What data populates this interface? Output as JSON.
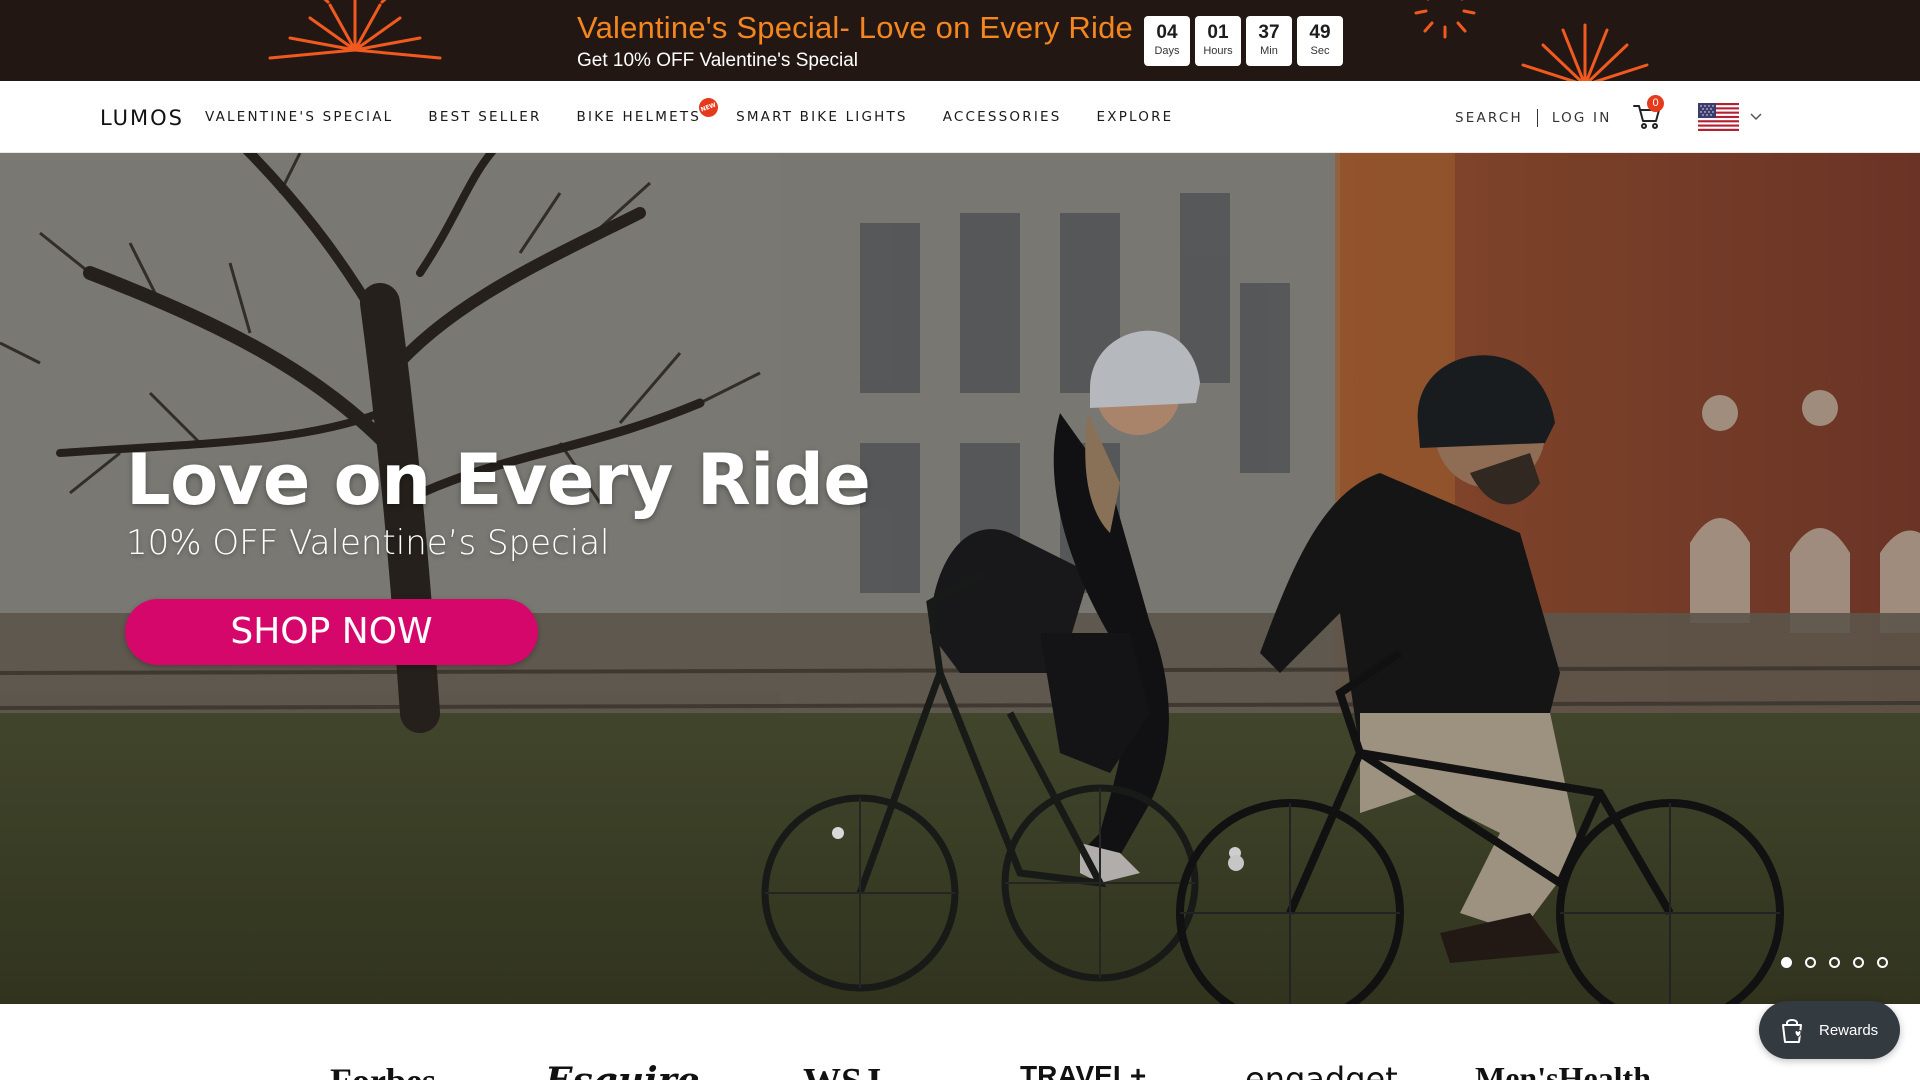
{
  "promo": {
    "title": "Valentine's Special- Love on Every Ride",
    "subtitle": "Get 10% OFF Valentine's Special",
    "countdown": [
      {
        "value": "04",
        "unit": "Days"
      },
      {
        "value": "01",
        "unit": "Hours"
      },
      {
        "value": "37",
        "unit": "Min"
      },
      {
        "value": "49",
        "unit": "Sec"
      }
    ],
    "colors": {
      "background": "#231714",
      "title": "#f4861f",
      "burst": "#f15a1f"
    }
  },
  "header": {
    "logo": "LUMOS",
    "nav": [
      {
        "label": "VALENTINE'S SPECIAL"
      },
      {
        "label": "BEST SELLER"
      },
      {
        "label": "BIKE HELMETS",
        "badge": "NEW"
      },
      {
        "label": "SMART BIKE LIGHTS"
      },
      {
        "label": "ACCESSORIES"
      },
      {
        "label": "EXPLORE"
      }
    ],
    "search_label": "SEARCH",
    "login_label": "LOG IN",
    "cart_count": "0",
    "cart_icon": "cart-icon",
    "country_flag": "us-flag-icon"
  },
  "hero": {
    "title": "Love on Every Ride",
    "subtitle": "10% OFF Valentine’s Special",
    "cta_label": "SHOP NOW",
    "cta_color": "#d6076b",
    "slides_total": 5,
    "active_slide": 1
  },
  "press": {
    "logos": [
      "Forbes",
      "Esquire",
      "WSJ",
      "TRAVEL+",
      "engadget",
      "Men'sHealth"
    ]
  },
  "rewards": {
    "label": "Rewards",
    "icon": "shopping-bag-heart-icon"
  }
}
